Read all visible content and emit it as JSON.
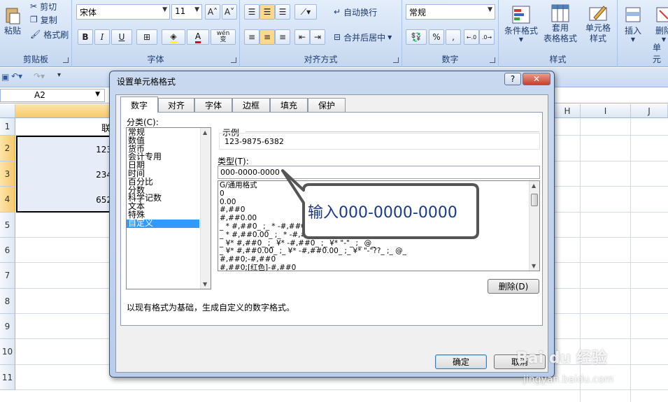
{
  "ribbon": {
    "clipboard": {
      "paste": "粘贴",
      "cut": "剪切",
      "copy": "复制",
      "format_painter": "格式刷",
      "label": "剪贴板"
    },
    "font": {
      "name": "宋体",
      "size": "11",
      "bold": "B",
      "italic": "I",
      "underline": "U",
      "phonetic": "wén",
      "phonetic_sub": "变",
      "label": "字体"
    },
    "alignment": {
      "wrap_text": "自动换行",
      "merge_center": "合并后居中",
      "label": "对齐方式"
    },
    "number": {
      "format": "常规",
      "percent": "%",
      "comma": ",",
      "label": "数字"
    },
    "styles": {
      "conditional": "条件格式",
      "table_format_1": "套用",
      "table_format_2": "表格格式",
      "cell_styles_1": "单元格",
      "cell_styles_2": "样式",
      "label": "样式"
    },
    "cells": {
      "insert": "插入",
      "delete": "删除",
      "label": "单元"
    }
  },
  "formula_bar": {
    "name_box": "A2"
  },
  "grid": {
    "columns": [
      "H",
      "I",
      "J"
    ],
    "rows": [
      "1",
      "2",
      "3",
      "4",
      "5",
      "6",
      "7",
      "8",
      "9",
      "10",
      "11"
    ],
    "cells": {
      "b1": "联",
      "b2": "123",
      "b3": "234",
      "b4": "652"
    }
  },
  "dialog": {
    "title": "设置单元格格式",
    "help": "?",
    "close": "✕",
    "tabs": [
      "数字",
      "对齐",
      "字体",
      "边框",
      "填充",
      "保护"
    ],
    "category_label": "分类(C):",
    "categories": [
      "常规",
      "数值",
      "货币",
      "会计专用",
      "日期",
      "时间",
      "百分比",
      "分数",
      "科学记数",
      "文本",
      "特殊",
      "自定义"
    ],
    "sample_label": "示例",
    "sample_value": "123-9875-6382",
    "type_label": "类型(T):",
    "type_value": "000-0000-0000",
    "formats": [
      "G/通用格式",
      "0",
      "0.00",
      "#,##0",
      "#,##0.00",
      "_ * #,##0_ ;_ * -#,##0_ ;_ * \"-\"_ ;_ @_",
      "_ * #,##0.00_ ;_ * -#,##0.00_ ;_ * \"-\"??_ ;_ @_",
      "_ ¥* #,##0_ ;_ ¥* -#,##0_ ;_ ¥* \"-\"_ ;_ @_",
      "_ ¥* #,##0.00_ ;_ ¥* -#,##0.00_ ;_ ¥* \"-\"??_ ;_ @_",
      "#,##0;-#,##0",
      "#,##0;[红色]-#,##0"
    ],
    "delete_button": "删除(D)",
    "description": "以现有格式为基础，生成自定义的数字格式。",
    "ok_button": "确定",
    "cancel_button": "取消"
  },
  "callout": {
    "text": "输入000-0000-0000"
  },
  "watermark": {
    "logo": "Bai du 经验",
    "url": "jingyan.baidu.com"
  },
  "colors": {
    "accent": "#3399ff",
    "callout_text": "#1a3a8c",
    "ribbon": "#cfdff4"
  }
}
